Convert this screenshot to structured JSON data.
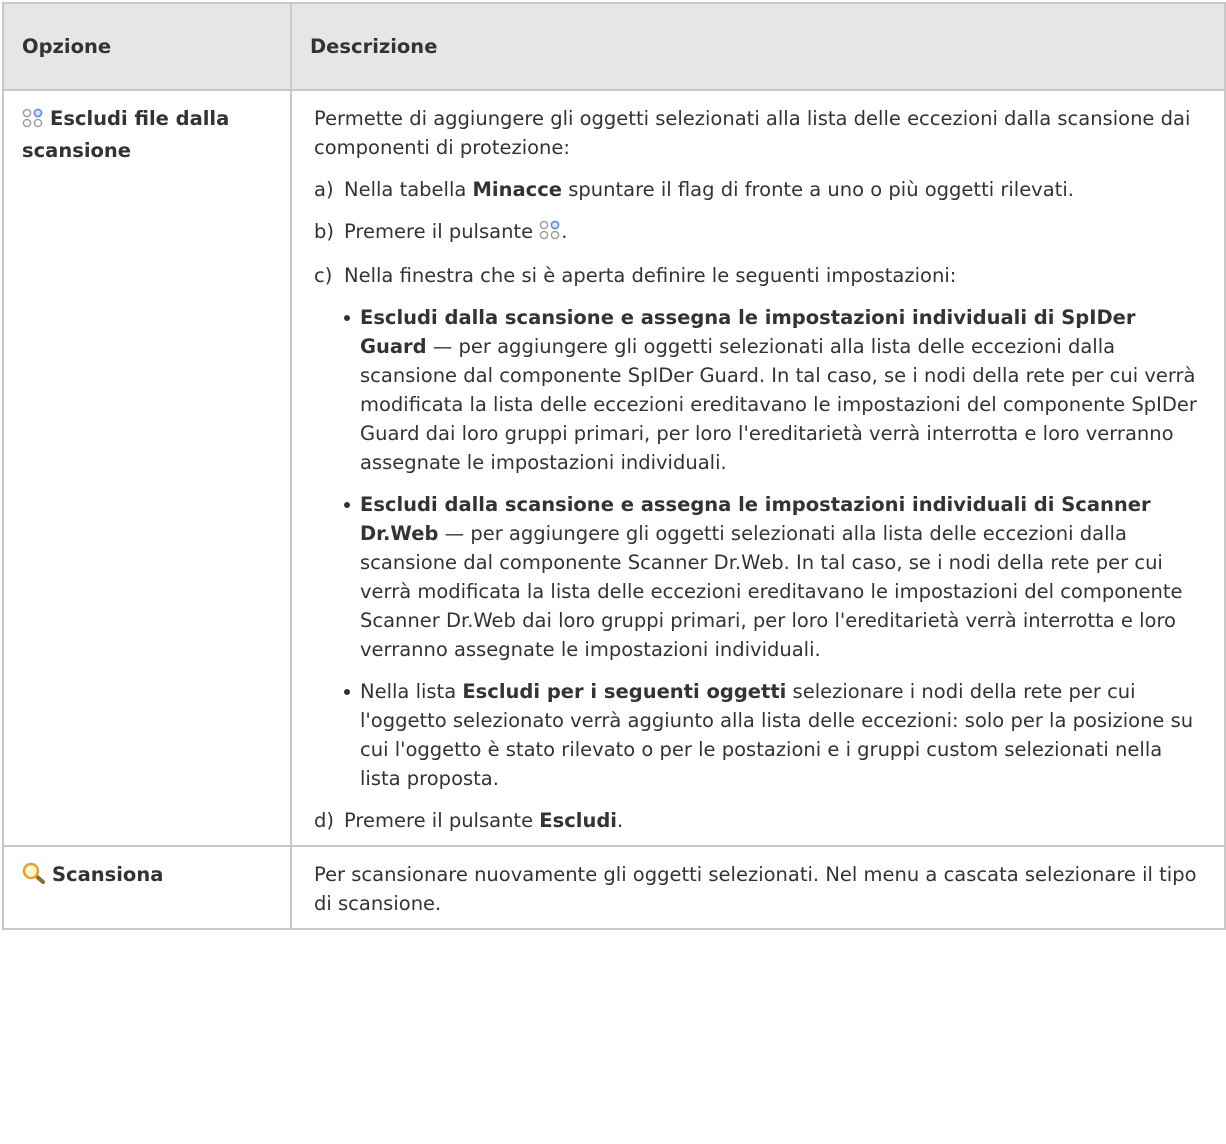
{
  "table": {
    "header": {
      "option": "Opzione",
      "description": "Descrizione"
    },
    "row1": {
      "icon": "exclude-scan-icon",
      "option": "Escludi file dalla scansione",
      "intro": "Permette di aggiungere gli oggetti selezionati alla lista delle eccezioni dalla scansione dai componenti di protezione:",
      "step_a": {
        "marker": "a)",
        "pre": "Nella tabella ",
        "bold": "Minacce",
        "post": " spuntare il flag di fronte a uno o più oggetti rilevati."
      },
      "step_b": {
        "marker": "b)",
        "pre": "Premere il pulsante ",
        "post": "."
      },
      "step_c": {
        "marker": "c)",
        "text": "Nella finestra che si è aperta definire le seguenti impostazioni:",
        "bullet1": {
          "bold": "Escludi dalla scansione e assegna le impostazioni individuali di SpIDer Guard",
          "text": " — per aggiungere gli oggetti selezionati alla lista delle eccezioni dalla scansione dal componente SpIDer Guard. In tal caso, se i nodi della rete per cui verrà modificata la lista delle eccezioni ereditavano le impostazioni del componente SpIDer Guard dai loro gruppi primari, per loro l'ereditarietà verrà interrotta e loro verranno assegnate le impostazioni individuali."
        },
        "bullet2": {
          "bold": "Escludi dalla scansione e assegna le impostazioni individuali di Scanner Dr.Web",
          "text": " — per aggiungere gli oggetti selezionati alla lista delle eccezioni dalla scansione dal componente Scanner Dr.Web. In tal caso, se i nodi della rete per cui verrà modificata la lista delle eccezioni ereditavano le impostazioni del componente Scanner Dr.Web dai loro gruppi primari, per loro l'ereditarietà verrà interrotta e loro verranno assegnate le impostazioni individuali."
        },
        "bullet3": {
          "pre": "Nella lista ",
          "bold": "Escludi per i seguenti oggetti",
          "text": " selezionare i nodi della rete per cui l'oggetto selezionato verrà aggiunto alla lista delle eccezioni: solo per la posizione su cui l'oggetto è stato rilevato o per le postazioni e i gruppi custom selezionati nella lista proposta."
        }
      },
      "step_d": {
        "marker": "d)",
        "pre": "Premere il pulsante ",
        "bold": "Escludi",
        "post": "."
      }
    },
    "row2": {
      "icon": "magnifier-scan-icon",
      "option": "Scansiona",
      "description": "Per scansionare nuovamente gli oggetti selezionati. Nel menu a cascata selezionare il tipo di scansione."
    }
  },
  "colors": {
    "header_bg": "#e6e6e6",
    "border": "#c8c8c8",
    "text": "#333333",
    "icon_blue": "#5b8fd6",
    "magnifier_gold": "#e0a030"
  }
}
